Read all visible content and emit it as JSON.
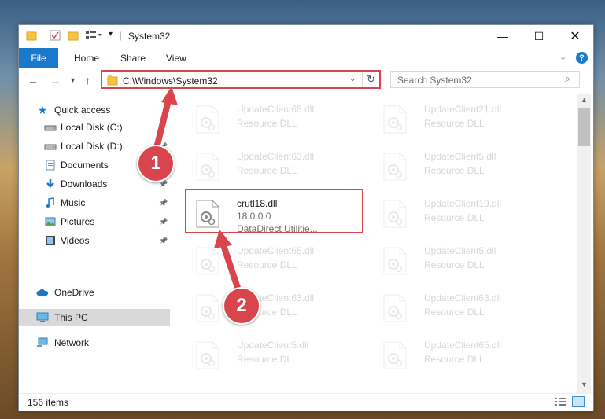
{
  "window": {
    "title": "System32"
  },
  "ribbon": {
    "file": "File",
    "home": "Home",
    "share": "Share",
    "view": "View"
  },
  "address": {
    "path": "C:\\Windows\\System32",
    "search_placeholder": "Search System32"
  },
  "nav": {
    "quick_access": "Quick access",
    "items": [
      {
        "label": "Local Disk (C:)",
        "icon": "drive-icon",
        "pinned": false
      },
      {
        "label": "Local Disk (D:)",
        "icon": "drive-icon",
        "pinned": true
      },
      {
        "label": "Documents",
        "icon": "documents-icon",
        "pinned": true
      },
      {
        "label": "Downloads",
        "icon": "downloads-icon",
        "pinned": true
      },
      {
        "label": "Music",
        "icon": "music-icon",
        "pinned": true
      },
      {
        "label": "Pictures",
        "icon": "pictures-icon",
        "pinned": true
      },
      {
        "label": "Videos",
        "icon": "videos-icon",
        "pinned": true
      }
    ],
    "onedrive": "OneDrive",
    "this_pc": "This PC",
    "network": "Network"
  },
  "files": {
    "col1": [
      {
        "name": "UpdateClient65.dll",
        "type": "Resource DLL"
      },
      {
        "name": "UpdateClient63.dll",
        "type": "Resource DLL"
      },
      {
        "name": "crutl18.dll",
        "version": "18.0.0.0",
        "company": "DataDirect Utilitie..."
      },
      {
        "name": "UpdateClient65.dll",
        "type": "Resource DLL"
      },
      {
        "name": "UpdateClient63.dll",
        "type": "Resource DLL"
      },
      {
        "name": "UpdateClient5.dll",
        "type": "Resource DLL"
      }
    ],
    "col2": [
      {
        "name": "UpdateClient21.dll",
        "type": "Resource DLL"
      },
      {
        "name": "UpdateClient5.dll",
        "type": "Resource DLL"
      },
      {
        "name": "UpdateClient19.dll",
        "type": "Resource DLL"
      },
      {
        "name": "UpdateClient5.dll",
        "type": "Resource DLL"
      },
      {
        "name": "UpdateClient63.dll",
        "type": "Resource DLL"
      },
      {
        "name": "UpdateClient65.dll",
        "type": "Resource DLL"
      }
    ]
  },
  "status": {
    "count": "156 items"
  },
  "callouts": {
    "one": "1",
    "two": "2"
  },
  "colors": {
    "accent": "#1979ca",
    "highlight": "#d9454d"
  }
}
